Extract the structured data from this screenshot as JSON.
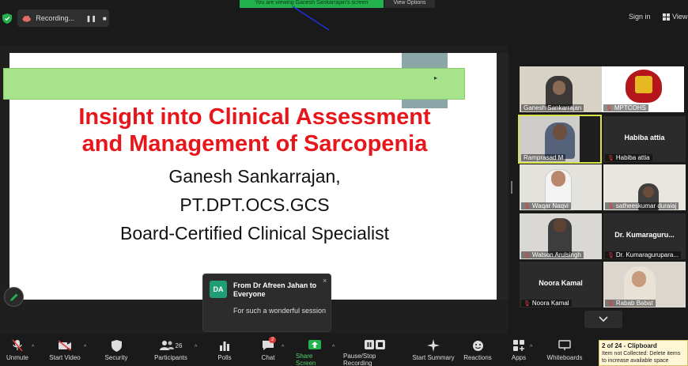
{
  "topbar": {
    "recording_label": "Recording...",
    "pause_glyph": "❚❚",
    "stop_glyph": "■",
    "share_banner": "You are viewing Ganesh Sankarrajan's screen",
    "view_options": "View Options",
    "signin": "Sign in",
    "view": "View"
  },
  "slide": {
    "title_line1": "Insight into Clinical Assessment",
    "title_line2": "and Management of Sarcopenia",
    "presenter": "Ganesh Sankarrajan,",
    "credentials": "PT.DPT.OCS.GCS",
    "specialty": "Board-Certified Clinical Specialist"
  },
  "chat_popup": {
    "avatar": "DA",
    "from": "From Dr Afreen Jahan to Everyone",
    "message": "For such a wonderful session",
    "close": "×"
  },
  "gallery": [
    {
      "name": "Ganesh Sankarrajan",
      "muted": false,
      "video": true
    },
    {
      "name": "MPTCOHS",
      "muted": true,
      "video": true
    },
    {
      "name": "Ramprasad M",
      "muted": false,
      "video": true,
      "active": true
    },
    {
      "name": "Habiba attia",
      "muted": true,
      "video": false,
      "display": "Habiba attia"
    },
    {
      "name": "Waqar Naqvi",
      "muted": true,
      "video": true
    },
    {
      "name": "satheeskumar duraiaj",
      "muted": true,
      "video": true
    },
    {
      "name": "Watson Arulsingh",
      "muted": true,
      "video": true
    },
    {
      "name": "Dr. Kumaragurupara...",
      "muted": true,
      "video": false,
      "display": "Dr.  Kumaraguru..."
    },
    {
      "name": "Noora Kamal",
      "muted": true,
      "video": false,
      "display": "Noora Kamal"
    },
    {
      "name": "Rabab Babat",
      "muted": true,
      "video": true
    }
  ],
  "toolbar": {
    "unmute": "Unmute",
    "start_video": "Start Video",
    "security": "Security",
    "participants": "Participants",
    "participants_count": "26",
    "polls": "Polls",
    "chat": "Chat",
    "chat_badge": "2",
    "share_screen": "Share Screen",
    "pause_stop": "Pause/Stop Recording",
    "start_summary": "Start Summary",
    "reactions": "Reactions",
    "apps": "Apps",
    "whiteboards": "Whiteboards"
  },
  "clipboard": {
    "title": "2 of 24 - Clipboard",
    "body": "Item not Collected: Delete items to increase available space"
  },
  "colors": {
    "title_red": "#e8161b",
    "share_green": "#22b14c",
    "mute_red": "#e03a3a",
    "active_border": "#d9e24a"
  }
}
